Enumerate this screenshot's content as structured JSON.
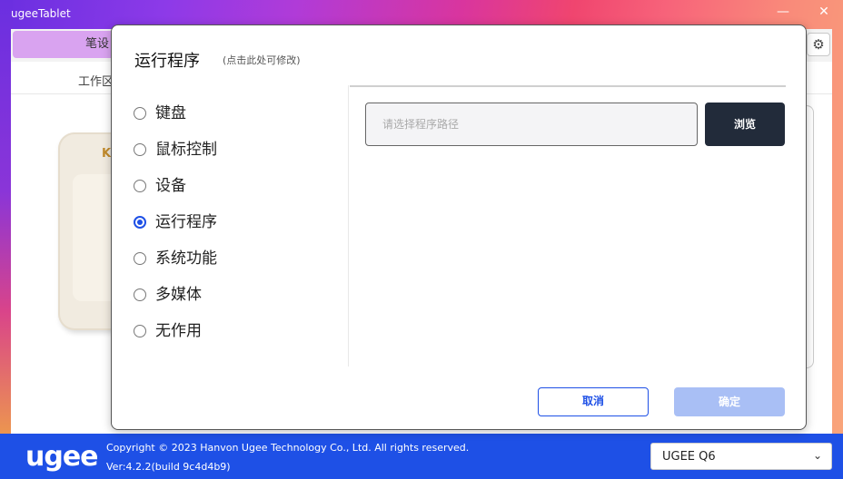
{
  "window": {
    "title": "ugeeTablet",
    "minimize_icon": "—",
    "close_icon": "✕"
  },
  "main": {
    "top_tab_label": "笔设",
    "sub_tab_label": "工作区",
    "tablet_brand": "K"
  },
  "modal": {
    "title": "运行程序",
    "hint": "(点击此处可修改)",
    "options": [
      {
        "label": "键盘",
        "checked": false
      },
      {
        "label": "鼠标控制",
        "checked": false
      },
      {
        "label": "设备",
        "checked": false
      },
      {
        "label": "运行程序",
        "checked": true
      },
      {
        "label": "系统功能",
        "checked": false
      },
      {
        "label": "多媒体",
        "checked": false
      },
      {
        "label": "无作用",
        "checked": false
      }
    ],
    "path_placeholder": "请选择程序路径",
    "browse_label": "浏览",
    "cancel_label": "取消",
    "ok_label": "确定"
  },
  "footer": {
    "logo": "ugee",
    "copyright": "Copyright © 2023 Hanvon Ugee Technology Co., Ltd. All rights reserved.",
    "version": "Ver:4.2.2(build 9c4d4b9)",
    "device": "UGEE Q6"
  },
  "colors": {
    "accent": "#1e50e6",
    "dark_button": "#222b3a",
    "disabled_button": "#a9bff5"
  }
}
